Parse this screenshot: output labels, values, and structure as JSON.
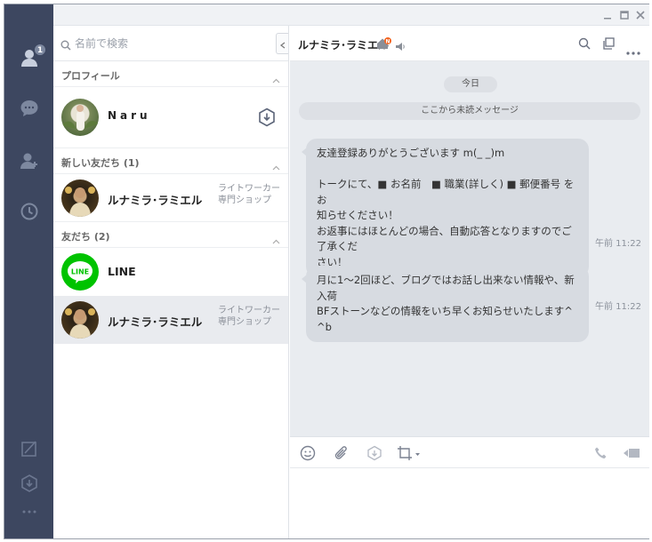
{
  "app": {
    "window_buttons": [
      "minimize-icon",
      "maximize-icon",
      "close-icon"
    ]
  },
  "rail": {
    "items": [
      {
        "icon": "friends-icon",
        "badge": "1"
      },
      {
        "icon": "chats-icon"
      },
      {
        "icon": "add-friend-icon"
      },
      {
        "icon": "timeline-icon"
      }
    ],
    "bottom_items": [
      {
        "icon": "keep-icon"
      },
      {
        "icon": "download-icon"
      },
      {
        "icon": "more-dots-icon"
      }
    ]
  },
  "friends": {
    "search_placeholder": "名前で検索",
    "profile_section": {
      "title": "プロフィール",
      "name": "Naru"
    },
    "new_friends_section": {
      "title": "新しい友だち (1)",
      "items": [
        {
          "name": "ルナミラ･ラミエル",
          "sub": "ライトワーカー専門ショップ"
        }
      ]
    },
    "friends_section": {
      "title": "友だち (2)",
      "items": [
        {
          "name": "LINE",
          "sub": ""
        },
        {
          "name": "ルナミラ･ラミエル",
          "sub": "ライトワーカー専門ショップ"
        }
      ]
    }
  },
  "chat": {
    "title": "ルナミラ･ラミエル",
    "home_badge": "N",
    "date_label": "今日",
    "unread_label": "ここから未読メッセージ",
    "messages": [
      {
        "text": "友達登録ありがとうございます m(_ _)m\n\nトークにて、■ お名前　■ 職業(詳しく) ■ 郵便番号 を お\n知らせください！\nお返事にはほとんどの場合、自動応答となりますのでご了承くだ\nさい！",
        "time": "午前 11:22"
      },
      {
        "text": "月に1～2回ほど、ブログではお話し出来ない情報や、新入荷\nBFストーンなどの情報をいち早くお知らせいたします^ ^b",
        "time": "午前 11:22"
      }
    ],
    "colors": {
      "bubble": "#d7dbe1",
      "background": "#e9ecf0",
      "rail": "#3d4760",
      "line_green": "#00c300",
      "badge_orange": "#f26522"
    }
  }
}
